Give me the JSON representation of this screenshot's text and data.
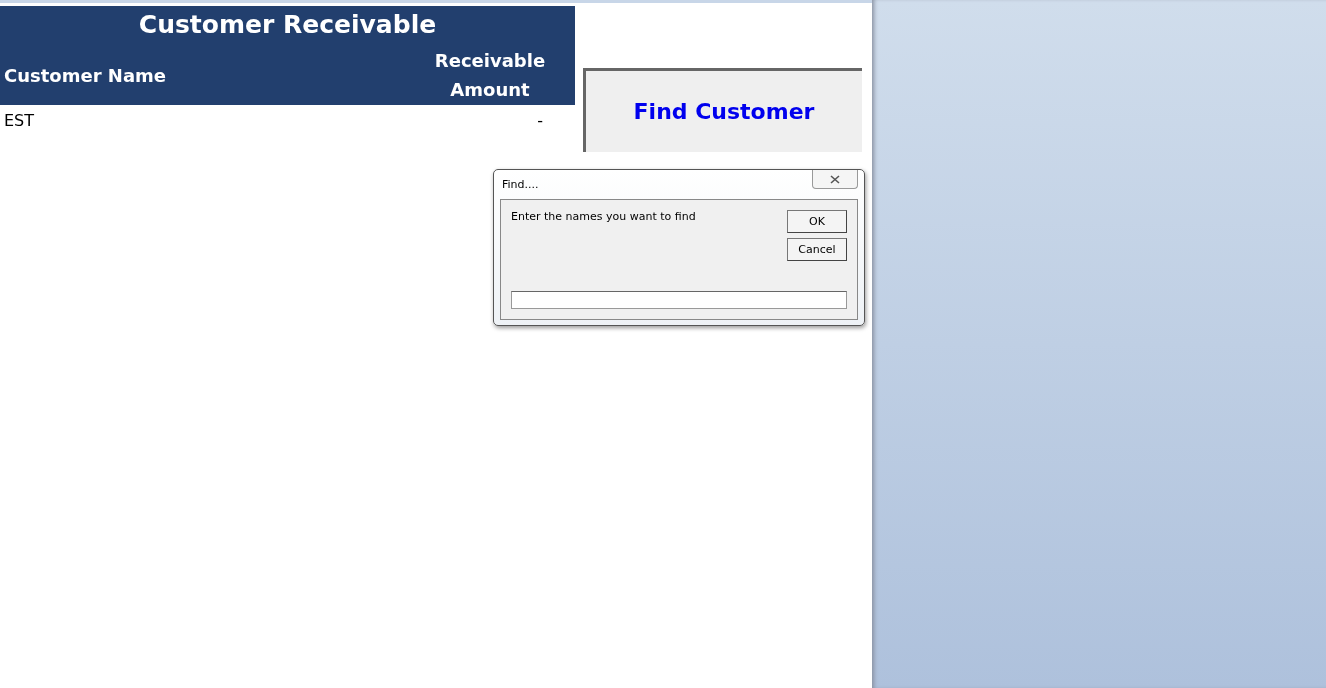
{
  "sheet": {
    "title": "Customer Receivable",
    "columns": [
      "Customer Name",
      "Receivable Amount"
    ],
    "rows": [
      {
        "name": "EST",
        "amount": "-"
      }
    ]
  },
  "find_button": {
    "label": "Find Customer"
  },
  "dialog": {
    "title": "Find....",
    "prompt": "Enter the names you want to find",
    "buttons": [
      "OK",
      "Cancel"
    ]
  }
}
